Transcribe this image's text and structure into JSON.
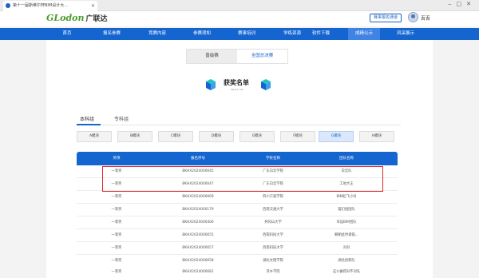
{
  "browser": {
    "tab_title": "第十一届斯维尔杯BIM设计大..."
  },
  "header": {
    "logo": "GLodon",
    "logo_cn": "广联达",
    "register_button": "赛事报名通道",
    "username": "吾吾"
  },
  "nav": {
    "items": [
      "首页",
      "报名参赛",
      "竞赛内容",
      "参赛须知",
      "赛事培训",
      "学练资源",
      "软件下载",
      "成绩公示",
      "风采展示"
    ],
    "active_index": 7
  },
  "toggle": {
    "left": "晋级赛",
    "right": "全国总决赛",
    "active": "全国总决赛"
  },
  "award_title": {
    "title": "获奖名单",
    "subtitle": "Award List"
  },
  "group_tabs": {
    "items": [
      "本科组",
      "专科组"
    ],
    "active": "本科组"
  },
  "modules": {
    "items": [
      "A模块",
      "B模块",
      "C模块",
      "D模块",
      "E模块",
      "F模块",
      "G模块",
      "H模块"
    ],
    "active": "G模块"
  },
  "table": {
    "headers": [
      "奖项",
      "报名序号",
      "学校名称",
      "团队名称"
    ],
    "rows": [
      [
        "一等奖",
        "BKHX2024000045",
        "广东白云学院",
        "白云队"
      ],
      [
        "一等奖",
        "BKHX2024000047",
        "广东白云学院",
        "工地大王"
      ],
      [
        "一等奖",
        "BKHX2024000069",
        "四川工程学院",
        "BIM起飞小对"
      ],
      [
        "一等奖",
        "BKHX2024000179",
        "西南交通大学",
        "猫们组团队"
      ],
      [
        "一等奖",
        "BKHX2024000406",
        "井冈山大学",
        "幸运BIM团队"
      ],
      [
        "一等奖",
        "BKHX2024000655",
        "西南科技大学",
        "朝朝此时者临..."
      ],
      [
        "一等奖",
        "BKHX2024000657",
        "西南科技大学",
        "对对"
      ],
      [
        "一等奖",
        "BKHX2024000658",
        "湖北文理学院",
        "湖北创新队"
      ],
      [
        "一等奖",
        "BKHX2024000681",
        "萍乡学院",
        "这么做得对不对队"
      ]
    ]
  },
  "colors": {
    "primary": "#1565d0",
    "highlight": "#e0262c",
    "logo_green": "#4a9a2a"
  }
}
